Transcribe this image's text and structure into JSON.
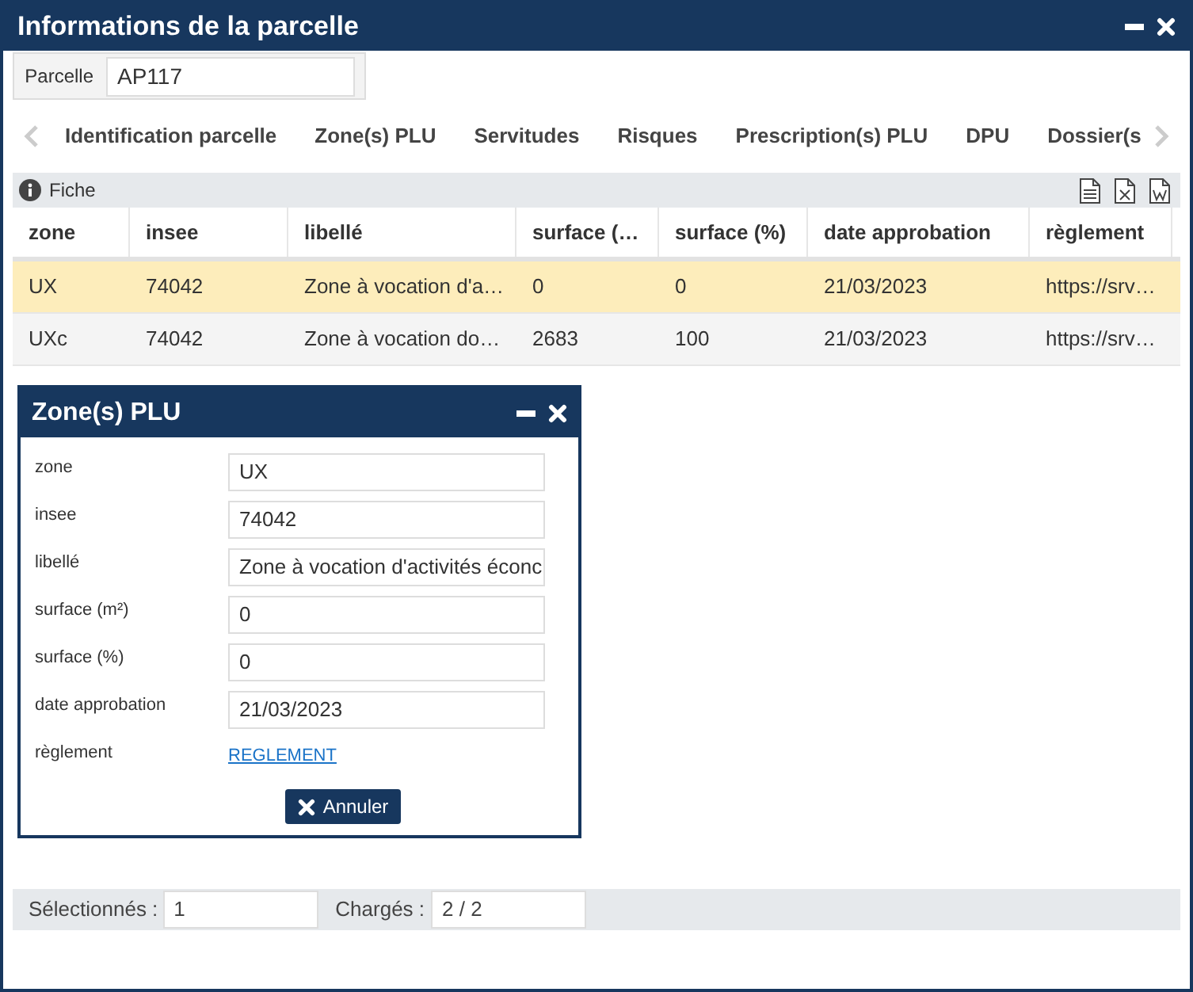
{
  "window": {
    "title": "Informations de la parcelle"
  },
  "parcel": {
    "label": "Parcelle",
    "value": "AP117"
  },
  "tabs": [
    {
      "label": "Identification parcelle"
    },
    {
      "label": "Zone(s) PLU"
    },
    {
      "label": "Servitudes"
    },
    {
      "label": "Risques"
    },
    {
      "label": "Prescription(s) PLU"
    },
    {
      "label": "DPU"
    },
    {
      "label": "Dossier(s"
    }
  ],
  "toolbar": {
    "label": "Fiche"
  },
  "table": {
    "columns": [
      "zone",
      "insee",
      "libellé",
      "surface (…",
      "surface (%)",
      "date approbation",
      "règlement"
    ],
    "rows": [
      {
        "selected": true,
        "cells": [
          "UX",
          "74042",
          "Zone à vocation d'a…",
          "0",
          "0",
          "21/03/2023",
          "https://srv…"
        ]
      },
      {
        "selected": false,
        "cells": [
          "UXc",
          "74042",
          "Zone à vocation do…",
          "2683",
          "100",
          "21/03/2023",
          "https://srv…"
        ]
      }
    ]
  },
  "dialog": {
    "title": "Zone(s) PLU",
    "fields": [
      {
        "kind": "input",
        "label": "zone",
        "value": "UX"
      },
      {
        "kind": "input",
        "label": "insee",
        "value": "74042"
      },
      {
        "kind": "input",
        "label": "libellé",
        "value": "Zone à vocation d'activités éconc"
      },
      {
        "kind": "input",
        "label": "surface (m²)",
        "value": "0"
      },
      {
        "kind": "input",
        "label": "surface (%)",
        "value": "0"
      },
      {
        "kind": "input",
        "label": "date approbation",
        "value": "21/03/2023"
      },
      {
        "kind": "link",
        "label": "règlement",
        "value": "REGLEMENT"
      }
    ],
    "button": "Annuler"
  },
  "status_bar": {
    "selected_label": "Sélectionnés :",
    "selected_value": "1",
    "loaded_label": "Chargés :",
    "loaded_value": "2 / 2"
  }
}
